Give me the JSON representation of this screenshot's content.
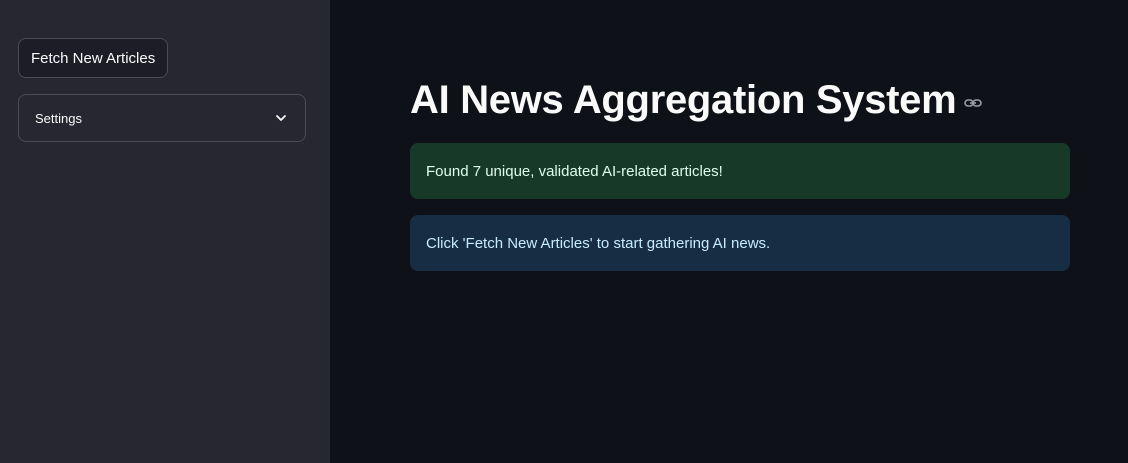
{
  "sidebar": {
    "fetch_button_label": "Fetch New Articles",
    "settings_expander": {
      "label": "Settings",
      "icon": "chevron-down-icon"
    }
  },
  "main": {
    "title": "AI News Aggregation System",
    "title_anchor_icon": "link-icon",
    "success_message": "Found 7 unique, validated AI-related articles!",
    "info_message": "Click 'Fetch New Articles' to start gathering AI news."
  },
  "colors": {
    "sidebar_bg": "#262730",
    "main_bg": "#0e1117",
    "success_bg": "#173928",
    "success_text": "#dffde9",
    "info_bg": "#172d43",
    "info_text": "#c7ebff"
  }
}
